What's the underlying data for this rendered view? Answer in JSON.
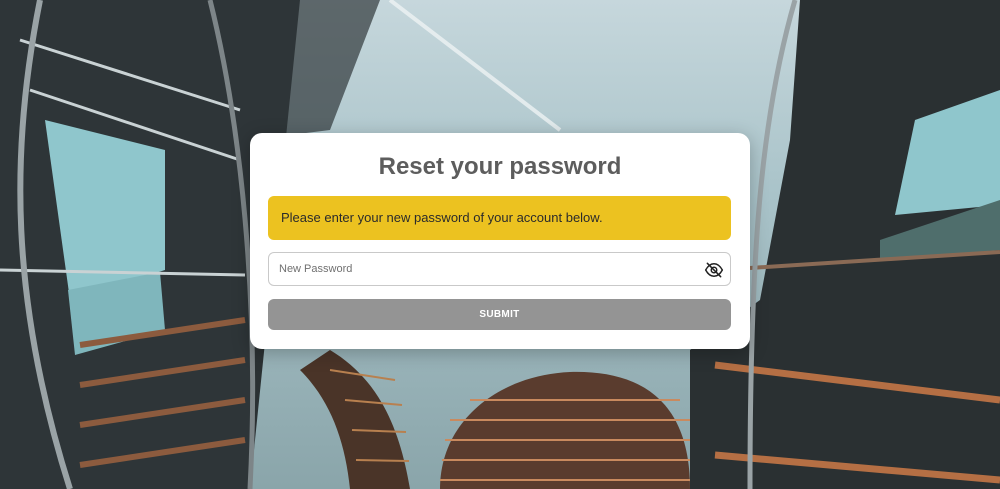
{
  "page": {
    "title": "Reset your password",
    "message": "Please enter your new password of your account below.",
    "password_field": {
      "placeholder": "New Password",
      "value": ""
    },
    "submit_label": "SUBMIT"
  },
  "icons": {
    "visibility_toggle": "eye-off-icon"
  },
  "colors": {
    "alert_background": "#ecc220",
    "submit_background": "#949494",
    "title_text": "#5d5d5d"
  }
}
